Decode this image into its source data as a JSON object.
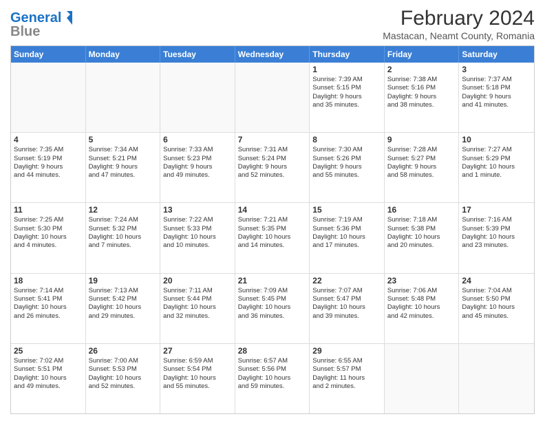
{
  "logo": {
    "line1": "General",
    "line2": "Blue"
  },
  "title": "February 2024",
  "subtitle": "Mastacan, Neamt County, Romania",
  "header_days": [
    "Sunday",
    "Monday",
    "Tuesday",
    "Wednesday",
    "Thursday",
    "Friday",
    "Saturday"
  ],
  "rows": [
    [
      {
        "day": "",
        "lines": []
      },
      {
        "day": "",
        "lines": []
      },
      {
        "day": "",
        "lines": []
      },
      {
        "day": "",
        "lines": []
      },
      {
        "day": "1",
        "lines": [
          "Sunrise: 7:39 AM",
          "Sunset: 5:15 PM",
          "Daylight: 9 hours",
          "and 35 minutes."
        ]
      },
      {
        "day": "2",
        "lines": [
          "Sunrise: 7:38 AM",
          "Sunset: 5:16 PM",
          "Daylight: 9 hours",
          "and 38 minutes."
        ]
      },
      {
        "day": "3",
        "lines": [
          "Sunrise: 7:37 AM",
          "Sunset: 5:18 PM",
          "Daylight: 9 hours",
          "and 41 minutes."
        ]
      }
    ],
    [
      {
        "day": "4",
        "lines": [
          "Sunrise: 7:35 AM",
          "Sunset: 5:19 PM",
          "Daylight: 9 hours",
          "and 44 minutes."
        ]
      },
      {
        "day": "5",
        "lines": [
          "Sunrise: 7:34 AM",
          "Sunset: 5:21 PM",
          "Daylight: 9 hours",
          "and 47 minutes."
        ]
      },
      {
        "day": "6",
        "lines": [
          "Sunrise: 7:33 AM",
          "Sunset: 5:23 PM",
          "Daylight: 9 hours",
          "and 49 minutes."
        ]
      },
      {
        "day": "7",
        "lines": [
          "Sunrise: 7:31 AM",
          "Sunset: 5:24 PM",
          "Daylight: 9 hours",
          "and 52 minutes."
        ]
      },
      {
        "day": "8",
        "lines": [
          "Sunrise: 7:30 AM",
          "Sunset: 5:26 PM",
          "Daylight: 9 hours",
          "and 55 minutes."
        ]
      },
      {
        "day": "9",
        "lines": [
          "Sunrise: 7:28 AM",
          "Sunset: 5:27 PM",
          "Daylight: 9 hours",
          "and 58 minutes."
        ]
      },
      {
        "day": "10",
        "lines": [
          "Sunrise: 7:27 AM",
          "Sunset: 5:29 PM",
          "Daylight: 10 hours",
          "and 1 minute."
        ]
      }
    ],
    [
      {
        "day": "11",
        "lines": [
          "Sunrise: 7:25 AM",
          "Sunset: 5:30 PM",
          "Daylight: 10 hours",
          "and 4 minutes."
        ]
      },
      {
        "day": "12",
        "lines": [
          "Sunrise: 7:24 AM",
          "Sunset: 5:32 PM",
          "Daylight: 10 hours",
          "and 7 minutes."
        ]
      },
      {
        "day": "13",
        "lines": [
          "Sunrise: 7:22 AM",
          "Sunset: 5:33 PM",
          "Daylight: 10 hours",
          "and 10 minutes."
        ]
      },
      {
        "day": "14",
        "lines": [
          "Sunrise: 7:21 AM",
          "Sunset: 5:35 PM",
          "Daylight: 10 hours",
          "and 14 minutes."
        ]
      },
      {
        "day": "15",
        "lines": [
          "Sunrise: 7:19 AM",
          "Sunset: 5:36 PM",
          "Daylight: 10 hours",
          "and 17 minutes."
        ]
      },
      {
        "day": "16",
        "lines": [
          "Sunrise: 7:18 AM",
          "Sunset: 5:38 PM",
          "Daylight: 10 hours",
          "and 20 minutes."
        ]
      },
      {
        "day": "17",
        "lines": [
          "Sunrise: 7:16 AM",
          "Sunset: 5:39 PM",
          "Daylight: 10 hours",
          "and 23 minutes."
        ]
      }
    ],
    [
      {
        "day": "18",
        "lines": [
          "Sunrise: 7:14 AM",
          "Sunset: 5:41 PM",
          "Daylight: 10 hours",
          "and 26 minutes."
        ]
      },
      {
        "day": "19",
        "lines": [
          "Sunrise: 7:13 AM",
          "Sunset: 5:42 PM",
          "Daylight: 10 hours",
          "and 29 minutes."
        ]
      },
      {
        "day": "20",
        "lines": [
          "Sunrise: 7:11 AM",
          "Sunset: 5:44 PM",
          "Daylight: 10 hours",
          "and 32 minutes."
        ]
      },
      {
        "day": "21",
        "lines": [
          "Sunrise: 7:09 AM",
          "Sunset: 5:45 PM",
          "Daylight: 10 hours",
          "and 36 minutes."
        ]
      },
      {
        "day": "22",
        "lines": [
          "Sunrise: 7:07 AM",
          "Sunset: 5:47 PM",
          "Daylight: 10 hours",
          "and 39 minutes."
        ]
      },
      {
        "day": "23",
        "lines": [
          "Sunrise: 7:06 AM",
          "Sunset: 5:48 PM",
          "Daylight: 10 hours",
          "and 42 minutes."
        ]
      },
      {
        "day": "24",
        "lines": [
          "Sunrise: 7:04 AM",
          "Sunset: 5:50 PM",
          "Daylight: 10 hours",
          "and 45 minutes."
        ]
      }
    ],
    [
      {
        "day": "25",
        "lines": [
          "Sunrise: 7:02 AM",
          "Sunset: 5:51 PM",
          "Daylight: 10 hours",
          "and 49 minutes."
        ]
      },
      {
        "day": "26",
        "lines": [
          "Sunrise: 7:00 AM",
          "Sunset: 5:53 PM",
          "Daylight: 10 hours",
          "and 52 minutes."
        ]
      },
      {
        "day": "27",
        "lines": [
          "Sunrise: 6:59 AM",
          "Sunset: 5:54 PM",
          "Daylight: 10 hours",
          "and 55 minutes."
        ]
      },
      {
        "day": "28",
        "lines": [
          "Sunrise: 6:57 AM",
          "Sunset: 5:56 PM",
          "Daylight: 10 hours",
          "and 59 minutes."
        ]
      },
      {
        "day": "29",
        "lines": [
          "Sunrise: 6:55 AM",
          "Sunset: 5:57 PM",
          "Daylight: 11 hours",
          "and 2 minutes."
        ]
      },
      {
        "day": "",
        "lines": []
      },
      {
        "day": "",
        "lines": []
      }
    ]
  ]
}
